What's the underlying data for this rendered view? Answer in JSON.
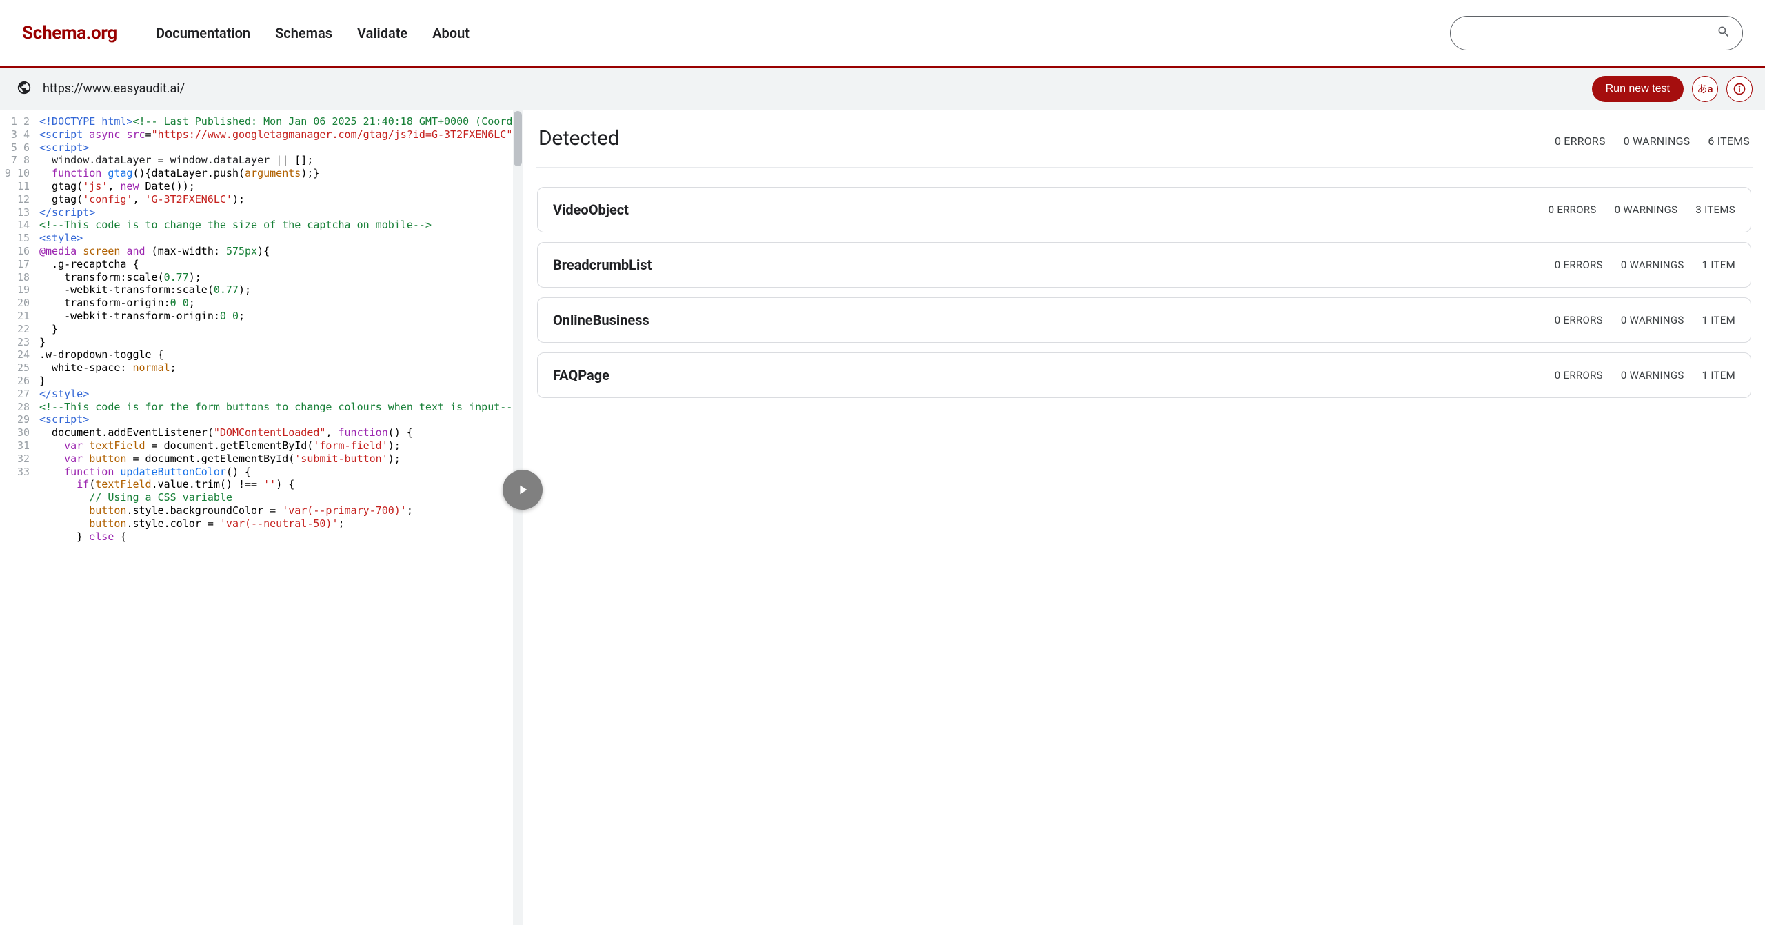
{
  "header": {
    "logo": "Schema.org",
    "nav": [
      "Documentation",
      "Schemas",
      "Validate",
      "About"
    ]
  },
  "toolbar": {
    "url": "https://www.easyaudit.ai/",
    "run_label": "Run new test",
    "lang_label": "あa"
  },
  "code": {
    "lines": 33
  },
  "results": {
    "title": "Detected",
    "summary": {
      "errors": "0 ERRORS",
      "warnings": "0 WARNINGS",
      "items": "6 ITEMS"
    },
    "cards": [
      {
        "name": "VideoObject",
        "errors": "0 ERRORS",
        "warnings": "0 WARNINGS",
        "items": "3 ITEMS"
      },
      {
        "name": "BreadcrumbList",
        "errors": "0 ERRORS",
        "warnings": "0 WARNINGS",
        "items": "1 ITEM"
      },
      {
        "name": "OnlineBusiness",
        "errors": "0 ERRORS",
        "warnings": "0 WARNINGS",
        "items": "1 ITEM"
      },
      {
        "name": "FAQPage",
        "errors": "0 ERRORS",
        "warnings": "0 WARNINGS",
        "items": "1 ITEM"
      }
    ]
  }
}
